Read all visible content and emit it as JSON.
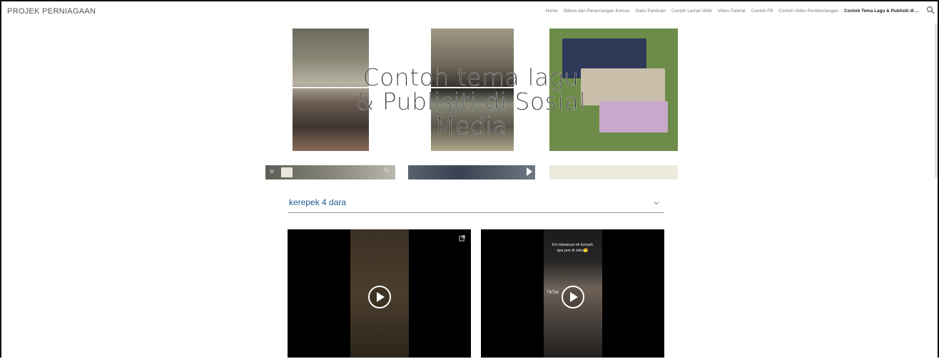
{
  "site": {
    "title": "PROJEK PERNIAGAAN"
  },
  "nav": {
    "items": [
      {
        "label": "Home"
      },
      {
        "label": "Silibus dan Perancangan Kursus"
      },
      {
        "label": "Garis Panduan"
      },
      {
        "label": "Contoh Laman Web"
      },
      {
        "label": "Video Tutorial"
      },
      {
        "label": "Contoh FB"
      },
      {
        "label": "Contoh Video Pembentangan"
      },
      {
        "label": "Contoh Tema Lagu & Publisiti di ..."
      }
    ],
    "active_index": 7,
    "search_icon": "search-icon"
  },
  "hero": {
    "title_line1": "Contoh tema lagu",
    "title_line2": "& Publisiti di Sosial",
    "title_line3": "Media"
  },
  "accordion": {
    "label": "kerepek 4 dara",
    "icon": "chevron-down-icon"
  },
  "videos": [
    {
      "icon": "play-icon",
      "external_icon": "external-link-icon"
    },
    {
      "icon": "play-icon",
      "caption_line1": "Em biasanya nk kunyah",
      "caption_line2": "apa pon tk tahu🤔",
      "overlay_text": "TikTok"
    }
  ],
  "colors": {
    "accent_link": "#1e5a8f",
    "active_nav": "#222222"
  }
}
